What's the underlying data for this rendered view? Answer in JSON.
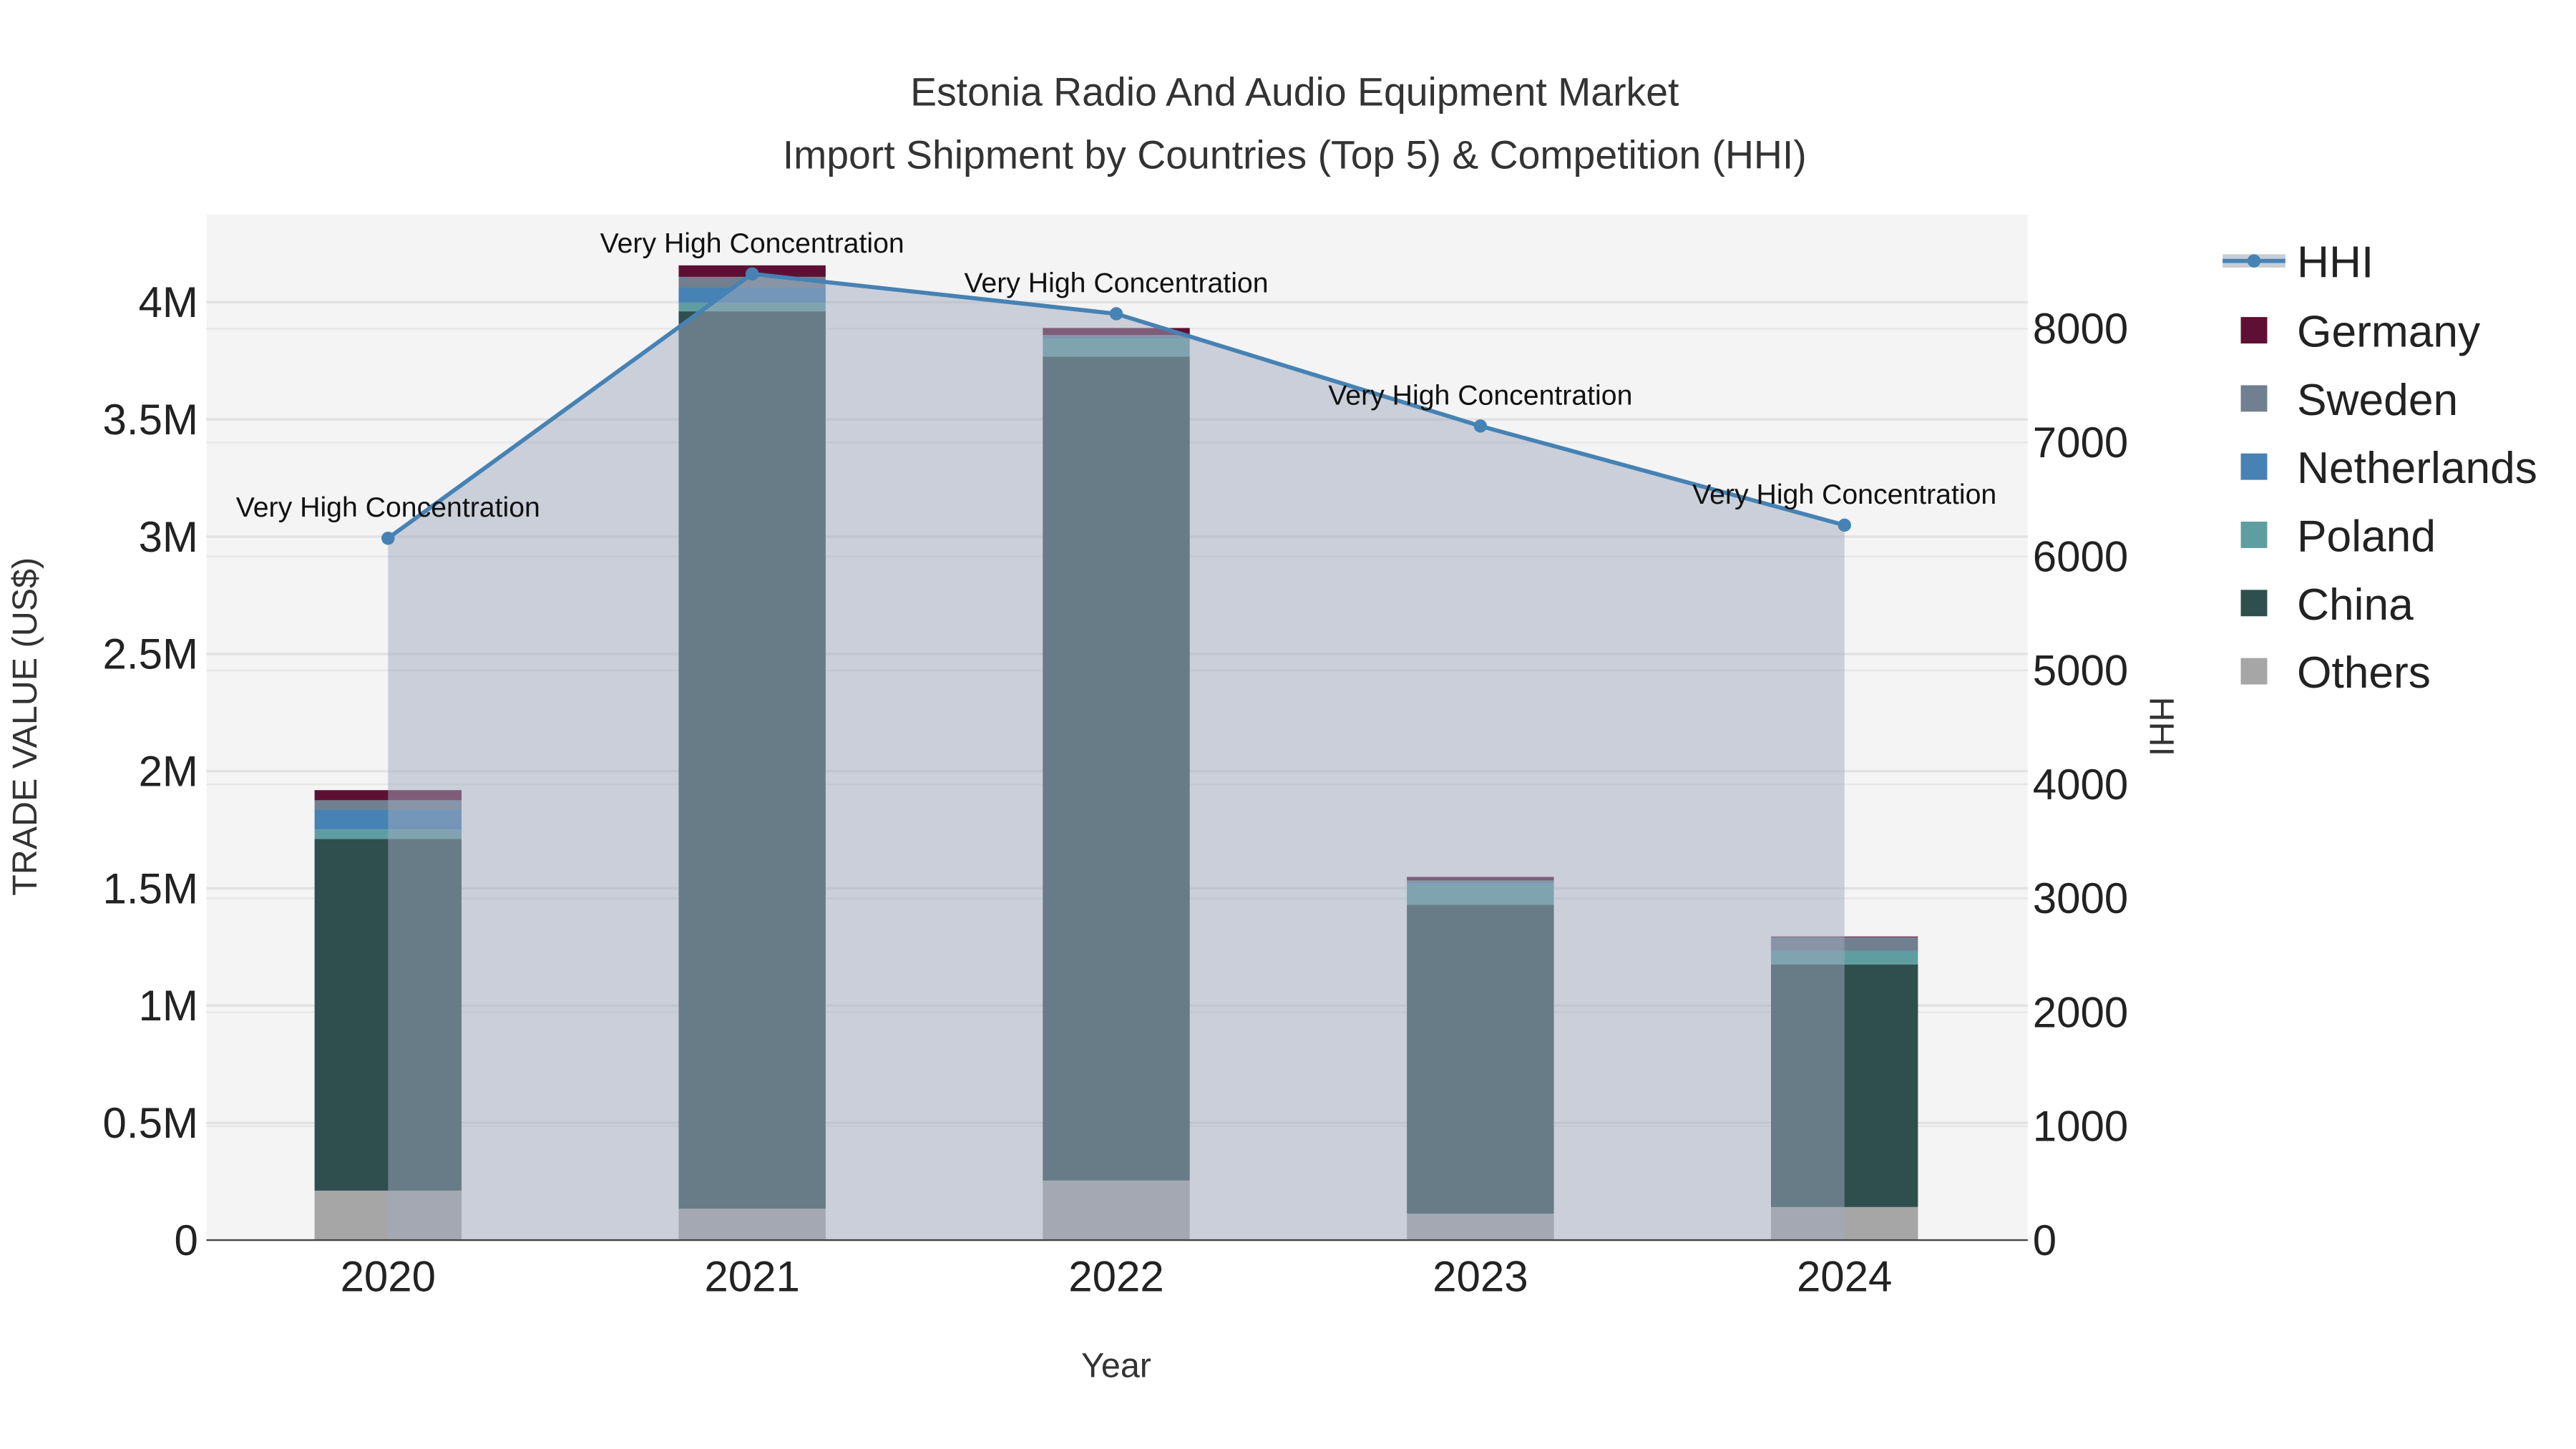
{
  "chart_data": {
    "type": "bar",
    "title_line1": "Estonia Radio And Audio Equipment Market",
    "title_line2": "Import Shipment by Countries (Top 5) & Competition (HHI)",
    "xlabel": "Year",
    "ylabel": "TRADE VALUE (US$)",
    "y2label": "HHI",
    "categories": [
      "2020",
      "2021",
      "2022",
      "2023",
      "2024"
    ],
    "ylim": [
      0,
      4360000
    ],
    "y2lim": [
      0,
      9000
    ],
    "yticks": [
      {
        "v": 0,
        "label": "0"
      },
      {
        "v": 500000,
        "label": "0.5M"
      },
      {
        "v": 1000000,
        "label": "1M"
      },
      {
        "v": 1500000,
        "label": "1.5M"
      },
      {
        "v": 2000000,
        "label": "2M"
      },
      {
        "v": 2500000,
        "label": "2.5M"
      },
      {
        "v": 3000000,
        "label": "3M"
      },
      {
        "v": 3500000,
        "label": "3.5M"
      },
      {
        "v": 4000000,
        "label": "4M"
      }
    ],
    "y2ticks": [
      {
        "v": 0,
        "label": "0"
      },
      {
        "v": 1000,
        "label": "1000"
      },
      {
        "v": 2000,
        "label": "2000"
      },
      {
        "v": 3000,
        "label": "3000"
      },
      {
        "v": 4000,
        "label": "4000"
      },
      {
        "v": 5000,
        "label": "5000"
      },
      {
        "v": 6000,
        "label": "6000"
      },
      {
        "v": 7000,
        "label": "7000"
      },
      {
        "v": 8000,
        "label": "8000"
      }
    ],
    "series": [
      {
        "name": "Others",
        "color": "#a6a6a6",
        "values": [
          211000,
          134000,
          254000,
          113000,
          141000
        ]
      },
      {
        "name": "China",
        "color": "#2f4f4f",
        "values": [
          1500000,
          3827000,
          3514000,
          1317000,
          1035000
        ]
      },
      {
        "name": "Poland",
        "color": "#5f9ea0",
        "values": [
          40000,
          37000,
          77000,
          91000,
          55000
        ]
      },
      {
        "name": "Netherlands",
        "color": "#4682b4",
        "values": [
          85000,
          64000,
          5000,
          5000,
          3000
        ]
      },
      {
        "name": "Sweden",
        "color": "#708090",
        "values": [
          40000,
          46000,
          10000,
          8000,
          58000
        ]
      },
      {
        "name": "Germany",
        "color": "#5e1034",
        "values": [
          43000,
          49000,
          30000,
          15000,
          3000
        ]
      }
    ],
    "hhi": {
      "name": "HHI",
      "color": "#4682b4",
      "values": [
        6160,
        8480,
        8130,
        7145,
        6275
      ]
    },
    "annotations": [
      "Very High Concentration",
      "Very High Concentration",
      "Very High Concentration",
      "Very High Concentration",
      "Very High Concentration"
    ],
    "legend_position": "right",
    "grid": true
  }
}
